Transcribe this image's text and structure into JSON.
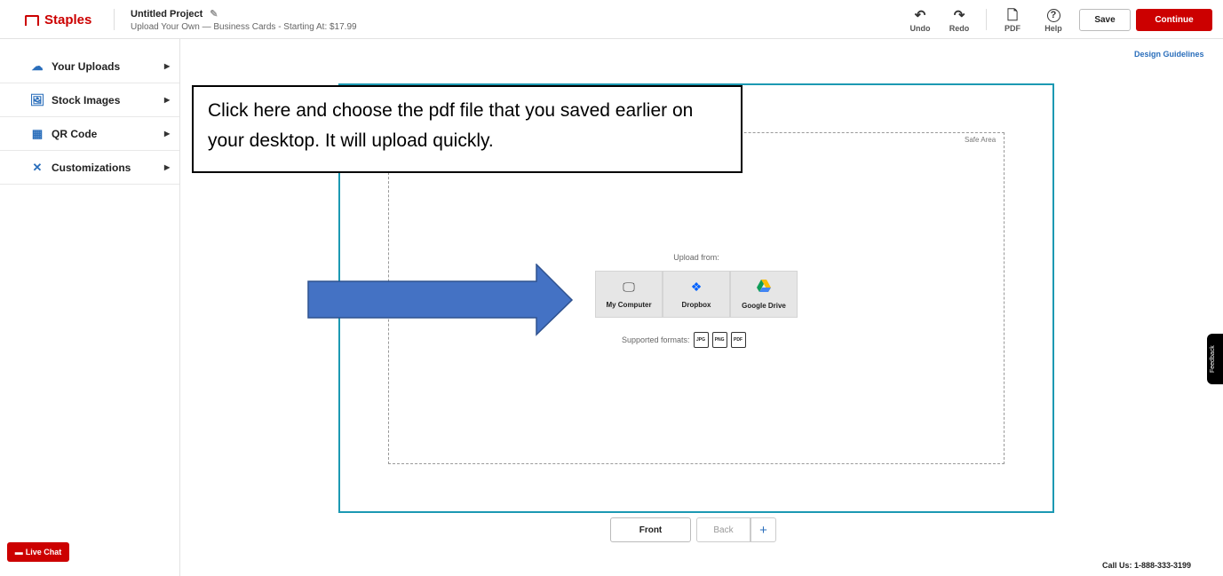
{
  "header": {
    "brand": "Staples",
    "project_title": "Untitled Project",
    "project_subtitle": "Upload Your Own  —  Business Cards - Starting At: $17.99",
    "tools": [
      {
        "label": "Undo",
        "icon": "undo-icon",
        "glyph": "↶"
      },
      {
        "label": "Redo",
        "icon": "redo-icon",
        "glyph": "↷"
      },
      {
        "label": "PDF",
        "icon": "pdf-icon",
        "glyph": "🗋"
      },
      {
        "label": "Help",
        "icon": "help-icon",
        "glyph": "?"
      }
    ],
    "save_label": "Save",
    "continue_label": "Continue",
    "accent_color": "#cc0000"
  },
  "sidebar": {
    "items": [
      {
        "label": "Your Uploads",
        "icon": "cloud-upload-icon"
      },
      {
        "label": "Stock Images",
        "icon": "image-search-icon"
      },
      {
        "label": "QR Code",
        "icon": "qr-code-icon"
      },
      {
        "label": "Customizations",
        "icon": "tools-icon"
      }
    ],
    "live_chat_label": "Live Chat"
  },
  "canvas": {
    "design_guidelines": "Design Guidelines",
    "safe_area_label": "Safe Area",
    "upload_from": "Upload from:",
    "upload_options": [
      {
        "label": "My Computer",
        "icon": "monitor-icon"
      },
      {
        "label": "Dropbox",
        "icon": "dropbox-icon"
      },
      {
        "label": "Google Drive",
        "icon": "google-drive-icon"
      }
    ],
    "supported_formats_label": "Supported formats:",
    "formats": [
      "JPG",
      "PNG",
      "PDF"
    ],
    "frame_color": "#1c99b3"
  },
  "annotation": {
    "callout_text": "Click here and choose the pdf file that you saved earlier on your desktop.  It will upload quickly.",
    "arrow_color": "#4472c4"
  },
  "sides": {
    "front_label": "Front",
    "back_label": "Back",
    "add_label": "+"
  },
  "footer": {
    "feedback_label": "Feedback",
    "call_us": "Call Us: 1-888-333-3199"
  }
}
